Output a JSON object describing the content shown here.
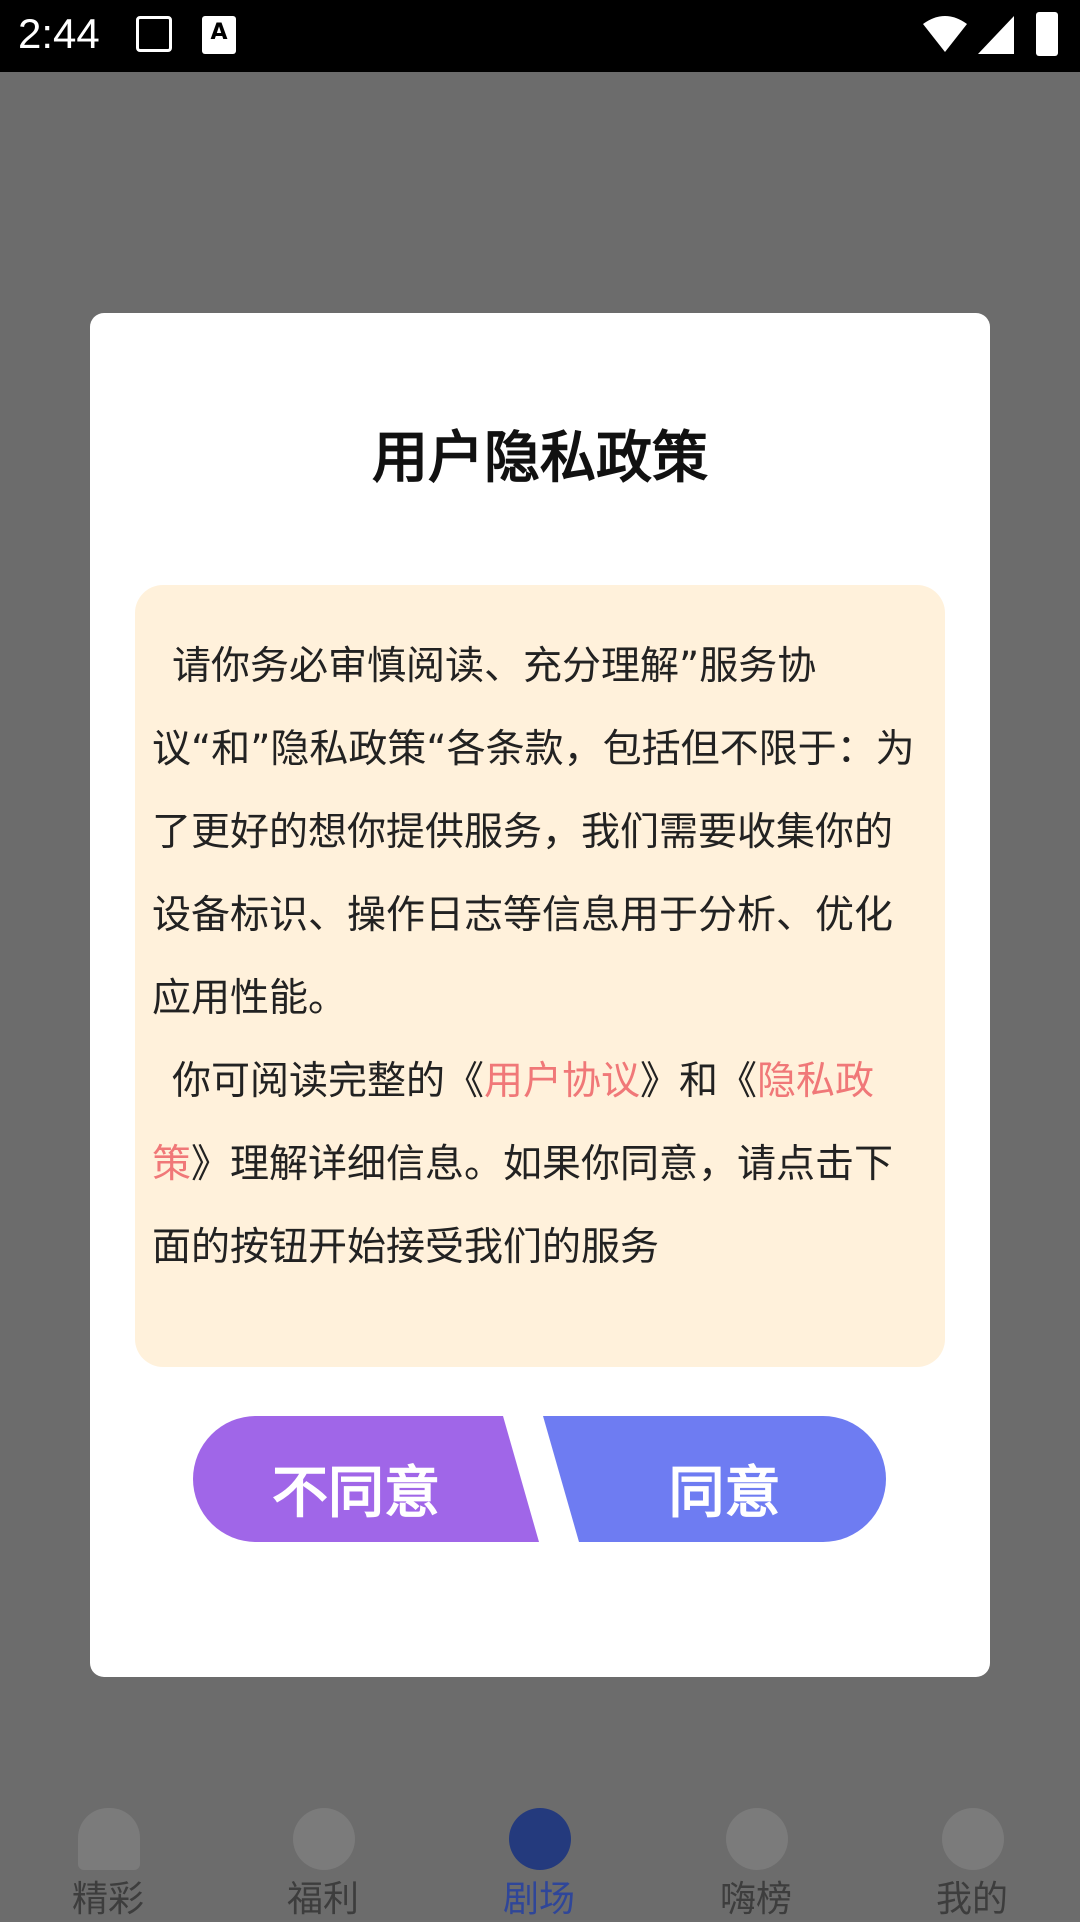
{
  "status_bar": {
    "time": "2:44"
  },
  "dialog": {
    "title": "用户隐私政策",
    "para1": "请你务必审慎阅读、充分理解”服务协议“和”隐私政策“各条款，包括但不限于：为了更好的想你提供服务，我们需要收集你的设备标识、操作日志等信息用于分析、优化应用性能。",
    "para2_prefix": "你可阅读完整的《",
    "link_user_agreement": "用户协议",
    "para2_mid": "》和《",
    "link_privacy_policy": "隐私政策",
    "para2_suffix": "》理解详细信息。如果你同意，请点击下面的按钮开始接受我们的服务",
    "disagree_label": "不同意",
    "agree_label": "同意"
  },
  "bottom_nav": {
    "items": [
      {
        "label": "精彩",
        "icon": "home-icon"
      },
      {
        "label": "福利",
        "icon": "planet-icon"
      },
      {
        "label": "剧场",
        "icon": "film-reel-icon",
        "active": true
      },
      {
        "label": "嗨榜",
        "icon": "medal-icon"
      },
      {
        "label": "我的",
        "icon": "profile-icon"
      }
    ]
  },
  "colors": {
    "link": "#f07878",
    "disagree_button": "#a066e8",
    "agree_button": "#6e7cf2",
    "body_background": "#fff1db",
    "active_tab": "#2f4699"
  }
}
